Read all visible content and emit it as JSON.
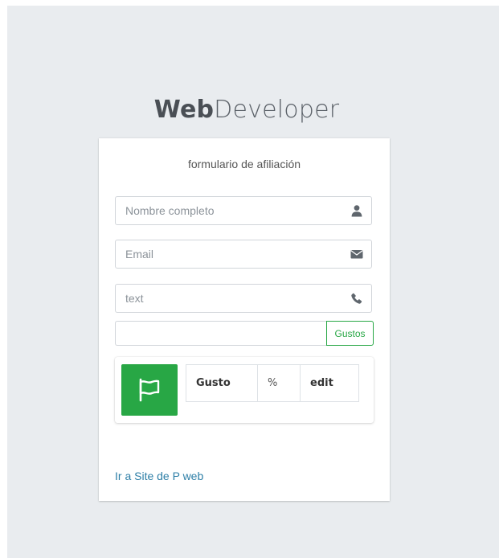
{
  "logo": {
    "bold": "Web",
    "light": "Developer"
  },
  "form": {
    "title": "formulario de afiliación",
    "fields": [
      {
        "placeholder": "Nombre completo",
        "icon": "user-icon"
      },
      {
        "placeholder": "Email",
        "icon": "envelope-icon"
      },
      {
        "placeholder": "text",
        "icon": "phone-icon"
      }
    ],
    "gustos": {
      "placeholder": "",
      "button_label": "Gustos"
    }
  },
  "info_box": {
    "icon": "flag-icon",
    "color": "#28a745",
    "columns": [
      "Gusto",
      "%",
      "edit"
    ]
  },
  "link": {
    "label": "Ir a Site de P web",
    "color": "#2e7fa7"
  }
}
